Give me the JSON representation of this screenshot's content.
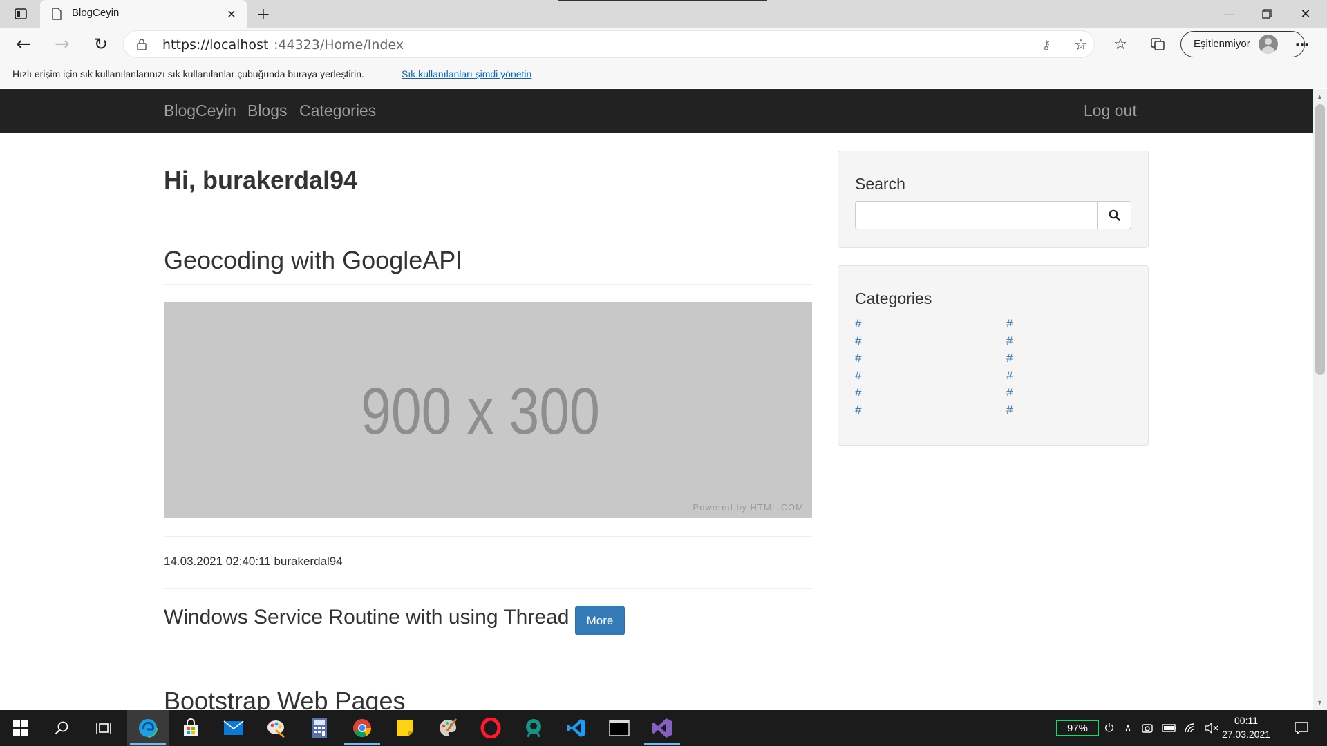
{
  "browser": {
    "tab_title": "BlogCeyin",
    "url_host": "https://localhost",
    "url_rest": ":44323/Home/Index",
    "profile_label": "Eşitlenmiyor",
    "favorites_hint": "Hızlı erişim için sık kullanılanlarınızı sık kullanılanlar çubuğunda buraya yerleştirin.",
    "favorites_link": "Sık kullanılanları şimdi yönetin"
  },
  "navbar": {
    "brand": "BlogCeyin",
    "links": [
      "Blogs",
      "Categories"
    ],
    "logout": "Log out"
  },
  "main": {
    "greeting": "Hi, burakerdal94",
    "posts": [
      {
        "title": "Geocoding with GoogleAPI",
        "image_text": "900 x 300",
        "image_credit": "Powered by HTML.COM",
        "meta": "14.03.2021 02:40:11 burakerdal94"
      }
    ],
    "inline_post_title": "Windows Service Routine with using Thread",
    "more_button": "More",
    "next_post_title": "Bootstrap Web Pages"
  },
  "sidebar": {
    "search_title": "Search",
    "search_placeholder": "",
    "categories_title": "Categories",
    "categories_left": [
      "#",
      "#",
      "#",
      "#",
      "#",
      "#"
    ],
    "categories_right": [
      "#",
      "#",
      "#",
      "#",
      "#",
      "#"
    ]
  },
  "taskbar": {
    "battery": "97%",
    "time": "00:11",
    "date": "27.03.2021"
  },
  "colors": {
    "navbar_bg": "#222222",
    "link": "#337ab7",
    "button": "#337ab7",
    "battery_accent": "#2ecc71"
  }
}
